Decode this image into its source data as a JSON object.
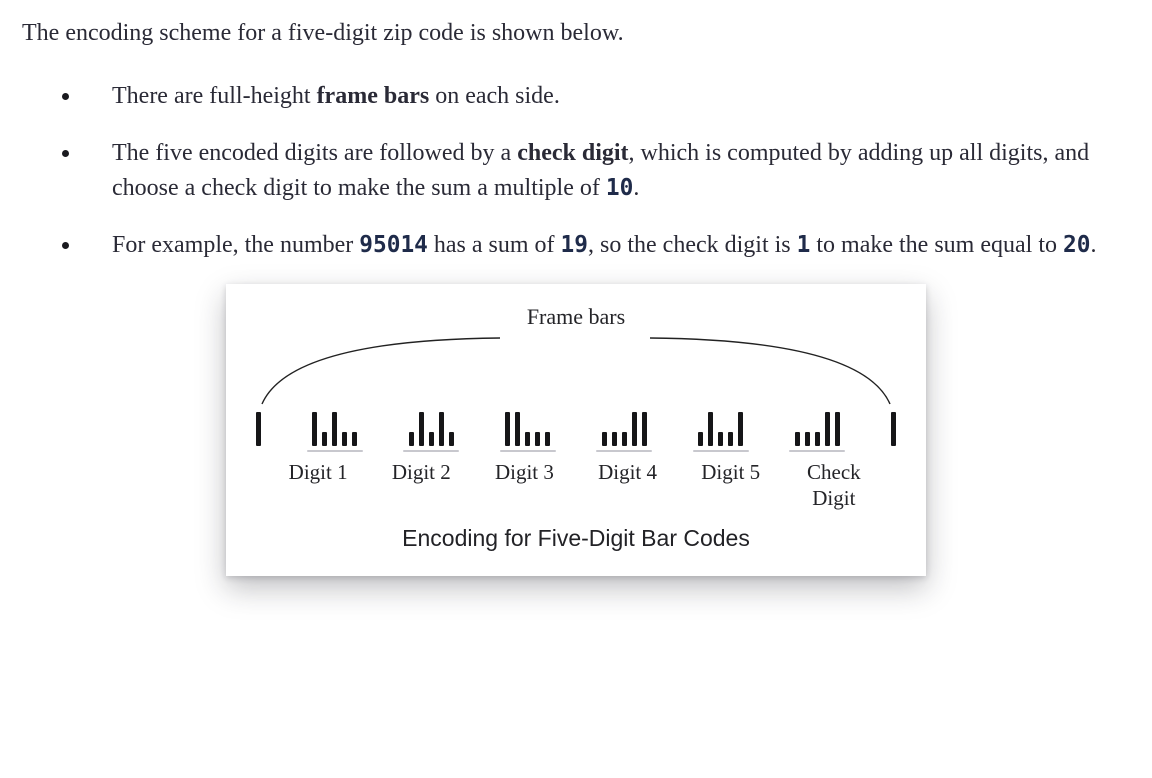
{
  "intro": "The encoding scheme for a five-digit zip code is shown below.",
  "bullets": {
    "b1": {
      "pre": "There are full-height ",
      "bold": "frame bars",
      "post": " on each side."
    },
    "b2": {
      "pre": "The five encoded digits are followed by a ",
      "bold": "check digit",
      "mid": ", which is computed by add­ing up all digits, and choose a check digit to make the sum a multiple of ",
      "mono": "10",
      "post": "."
    },
    "b3": {
      "pre": "For example, the number ",
      "mono1": "95014",
      "mid1": " has a sum of ",
      "mono2": "19",
      "mid2": ", so the check digit is ",
      "mono3": "1",
      "mid3": " to make the sum equal to ",
      "mono4": "20",
      "post": "."
    }
  },
  "figure": {
    "frame_label": "Frame bars",
    "labels": [
      "Digit 1",
      "Digit 2",
      "Digit 3",
      "Digit 4",
      "Digit 5",
      "Check\nDigit"
    ],
    "caption": "Encoding for Five-Digit Bar Codes",
    "groups": [
      {
        "name": "frame-left",
        "pattern": [
          "tall"
        ]
      },
      {
        "name": "digit-1",
        "pattern": [
          "tall",
          "short",
          "tall",
          "short",
          "short"
        ]
      },
      {
        "name": "digit-2",
        "pattern": [
          "short",
          "tall",
          "short",
          "tall",
          "short"
        ]
      },
      {
        "name": "digit-3",
        "pattern": [
          "tall",
          "tall",
          "short",
          "short",
          "short"
        ]
      },
      {
        "name": "digit-4",
        "pattern": [
          "short",
          "short",
          "short",
          "tall",
          "tall"
        ]
      },
      {
        "name": "digit-5",
        "pattern": [
          "short",
          "tall",
          "short",
          "short",
          "tall"
        ]
      },
      {
        "name": "check-digit",
        "pattern": [
          "short",
          "short",
          "short",
          "tall",
          "tall"
        ]
      },
      {
        "name": "frame-right",
        "pattern": [
          "tall"
        ]
      }
    ]
  }
}
